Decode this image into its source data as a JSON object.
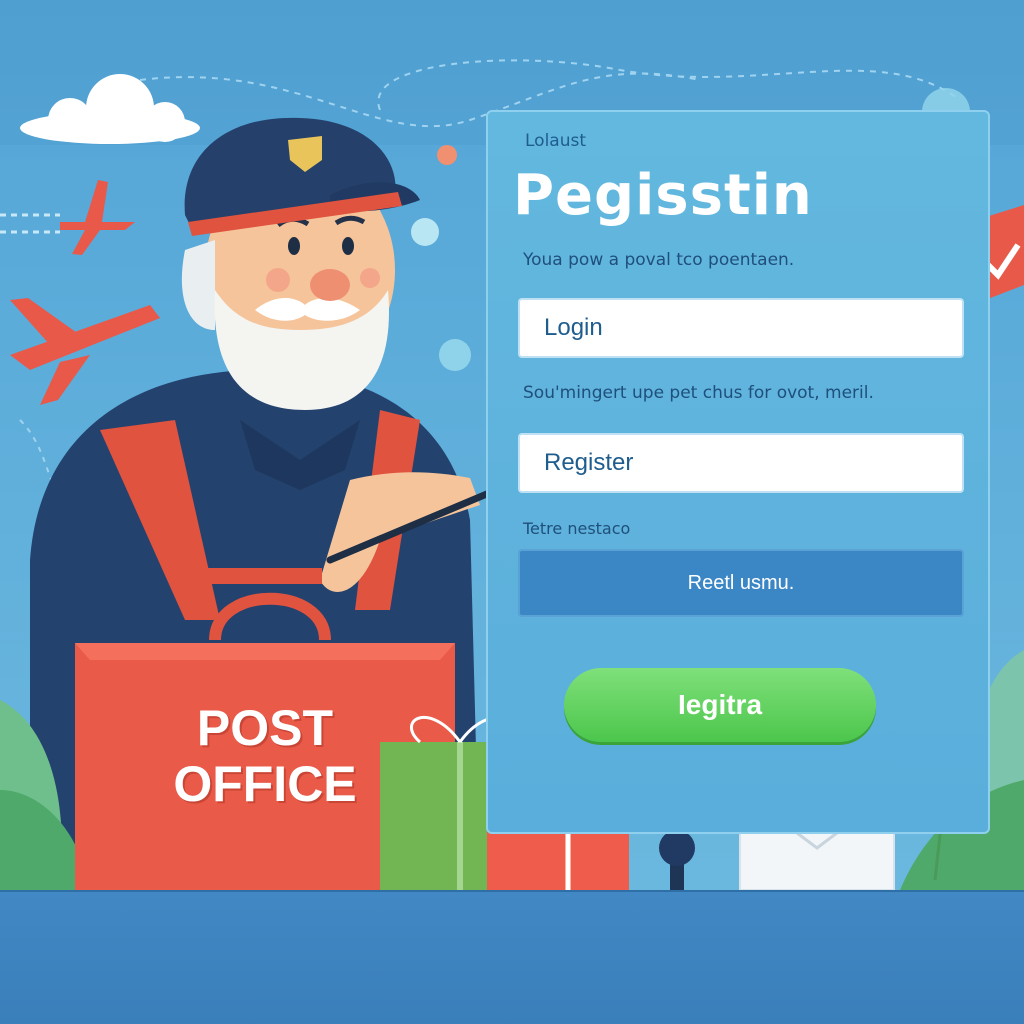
{
  "register_form": {
    "kicker": "Lolaust",
    "title": "Pegisstin",
    "subtitle": "Youa pow a poval tco poentaen.",
    "login_field_value": "Login",
    "note": "Sou'mingert upe pet chus for ovot, meril.",
    "register_field_value": "Register",
    "note2": "Tetre nestaco",
    "reset_button_label": "Reetl usmu.",
    "submit_button_label": "Iegitra"
  },
  "illustration": {
    "bag_label": "POST\nOFFICE"
  },
  "colors": {
    "background": "#4d9fd0",
    "panel": "#5aaedb",
    "accent_red": "#e8594a",
    "button_blue": "#3b86c5",
    "button_green": "#4cc64c",
    "cap_navy": "#25406b"
  }
}
